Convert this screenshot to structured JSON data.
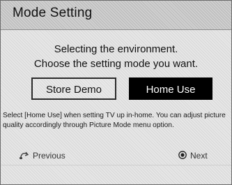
{
  "title": "Mode Setting",
  "message": {
    "line1": "Selecting the environment.",
    "line2": "Choose the setting mode you want."
  },
  "buttons": {
    "store_demo": "Store Demo",
    "home_use": "Home Use",
    "selected": "home_use"
  },
  "description": "Select [Home Use] when setting TV up in-home. You can adjust picture quality accordingly through Picture Mode menu option.",
  "footer": {
    "previous": {
      "label": "Previous",
      "icon": "return-icon"
    },
    "next": {
      "label": "Next",
      "icon": "enter-icon"
    }
  }
}
